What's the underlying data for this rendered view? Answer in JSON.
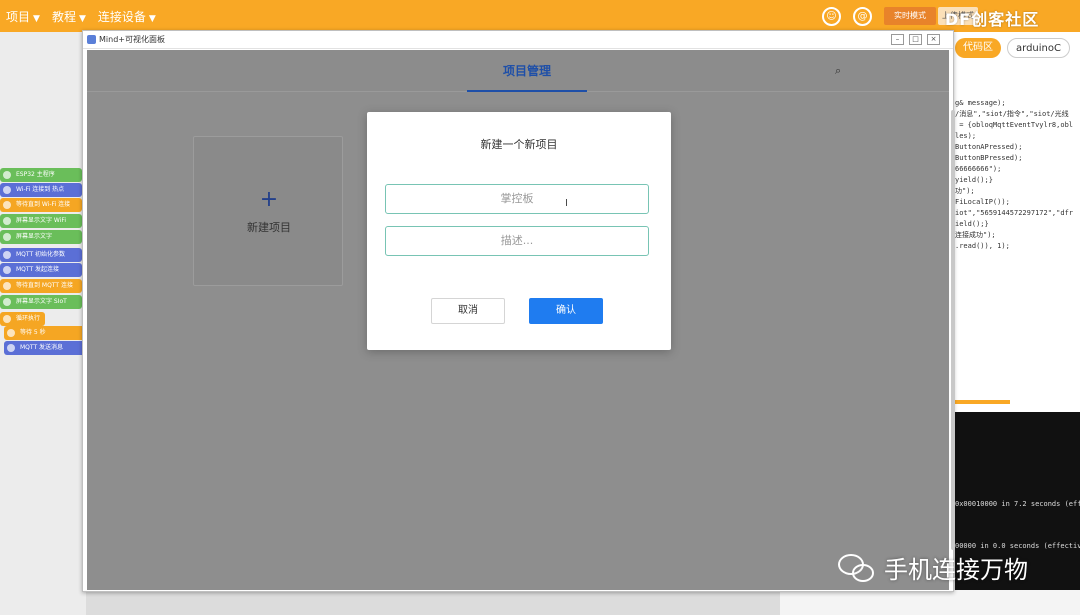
{
  "menu": {
    "items": [
      "项目",
      "教程",
      "连接设备"
    ]
  },
  "topbar": {
    "mode_button": "实时模式",
    "mode_button2": "上传模式",
    "watermark": "DF创客社区"
  },
  "code_tabs": {
    "active": "代码区",
    "second": "arduinoC"
  },
  "code_lines": [
    "g& message);",
    "",
    "/消息\",\"siot/指令\",\"siot/光线",
    " = {obloqMqttEventTvylr8,obl",
    "",
    "",
    "",
    "",
    "",
    "les);",
    "ButtonAPressed);",
    "ButtonBPressed);",
    "66666666\");",
    "yield();}",
    "",
    "功\");",
    "",
    "",
    "FiLocalIP());",
    "iot\",\"5659144572297172\",\"dfr",
    "",
    "ield();}",
    "",
    "连接成功\");",
    "",
    "",
    "",
    ".read()), 1);"
  ],
  "console_lines": [
    "0x00010000 in 7.2 seconds (eff",
    "00000 in 0.0 seconds (effectiv"
  ],
  "blocks": [
    {
      "label": "ESP32 主程序",
      "color": "green"
    },
    {
      "label": "Wi-Fi 连接到 热点",
      "color": "blue"
    },
    {
      "label": "等待直到 Wi-Fi 连接",
      "color": "orange"
    },
    {
      "label": "屏幕显示文字 WiFi",
      "color": "green"
    },
    {
      "label": "屏幕显示文字",
      "color": "green"
    },
    {
      "label": "MQTT 初始化参数",
      "color": "blue"
    },
    {
      "label": "MQTT 发起连接",
      "color": "blue"
    },
    {
      "label": "等待直到 MQTT 连接",
      "color": "orange"
    },
    {
      "label": "屏幕显示文字 SIoT",
      "color": "green"
    },
    {
      "label": "循环执行",
      "color": "orange"
    },
    {
      "label": "等待 5 秒",
      "color": "orange"
    },
    {
      "label": "MQTT 发送消息",
      "color": "blue"
    }
  ],
  "window": {
    "title": "Mind+可视化面板",
    "tab": "项目管理",
    "new_project_label": "新建项目",
    "plus_icon": "+",
    "search_icon": "⌕"
  },
  "modal": {
    "title": "新建一个新项目",
    "name_value": "掌控板",
    "desc_placeholder": "描述...",
    "cancel_label": "取消",
    "ok_label": "确认"
  },
  "watermark_bottom": {
    "text": "手机连接万物"
  },
  "colors": {
    "brand_orange": "#f9a825",
    "primary_blue": "#1f7cf0",
    "tab_blue": "#1e4fa8",
    "input_border": "#78c4b4"
  }
}
